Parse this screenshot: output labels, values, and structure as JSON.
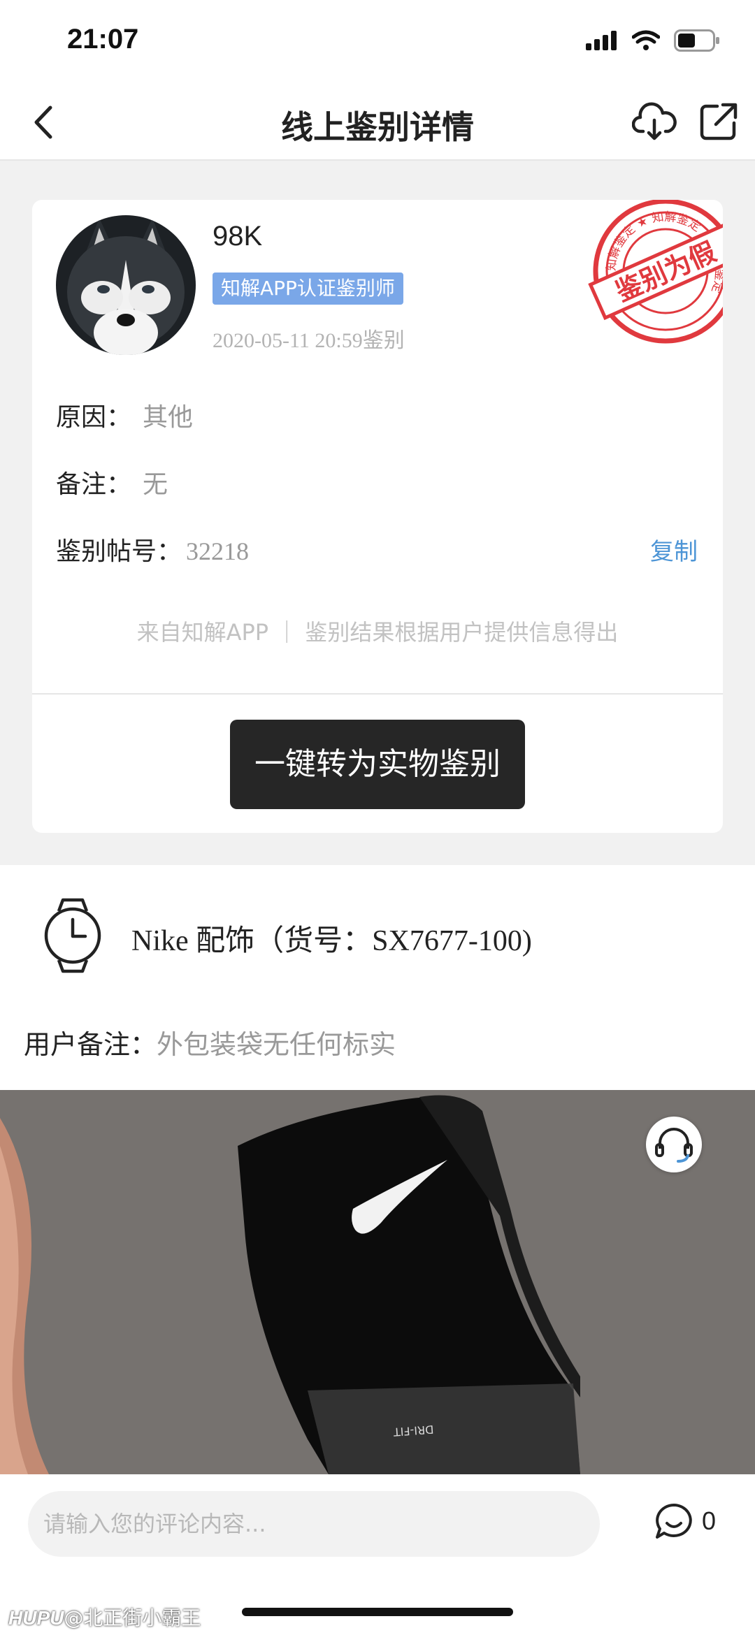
{
  "status_bar": {
    "time": "21:07"
  },
  "nav": {
    "title": "线上鉴别详情"
  },
  "appraiser": {
    "name": "98K",
    "badge": "知解APP认证鉴别师",
    "time": "2020-05-11 20:59鉴别"
  },
  "stamp": {
    "text": "鉴别为假",
    "ring_text": "知解鉴定 ★ 知解鉴定 ★ 知解鉴定"
  },
  "details": {
    "reason_label": "原因：",
    "reason_value": "其他",
    "note_label": "备注：",
    "note_value": "无",
    "post_label": "鉴别帖号：",
    "post_value": "32218",
    "copy_label": "复制"
  },
  "disclaimer": "来自知解APP ｜ 鉴别结果根据用户提供信息得出",
  "convert_button": "一键转为实物鉴别",
  "product": {
    "name": "Nike 配饰（货号：SX7677-100)",
    "remark_label": "用户备注：",
    "remark_value": "外包装袋无任何标实"
  },
  "comment": {
    "placeholder": "请输入您的评论内容...",
    "count": "0"
  },
  "watermark": {
    "brand": "HUPU",
    "user": "@北正街小霸王"
  },
  "colors": {
    "stamp": "#e0393e",
    "badge": "#7aa7e8",
    "link": "#4d95d6",
    "button": "#262626"
  },
  "icons": [
    "back-arrow-icon",
    "cloud-download-icon",
    "share-icon",
    "watch-icon",
    "headset-icon",
    "comment-bubble-icon"
  ]
}
